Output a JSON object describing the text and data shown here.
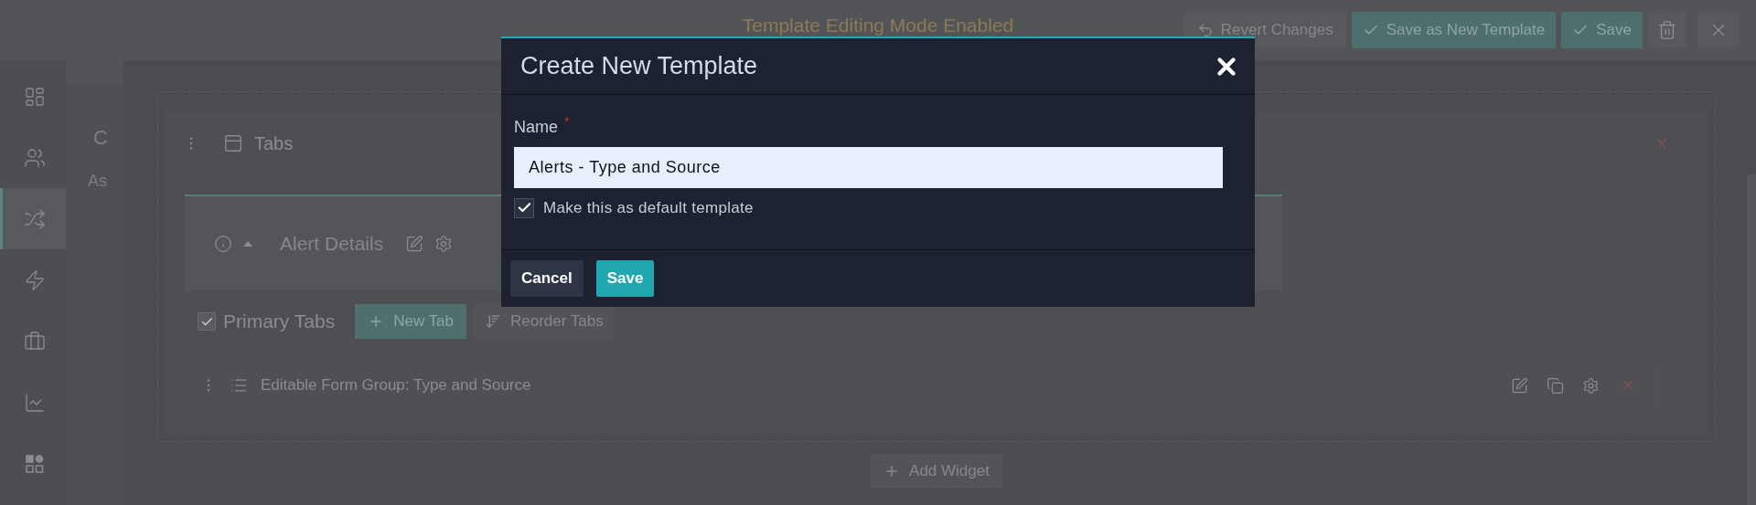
{
  "topbar": {
    "title": "Template Editing Mode Enabled",
    "actions": [
      {
        "label": "Revert Changes",
        "kind": "revert"
      },
      {
        "label": "Save as New Template",
        "kind": "confirm"
      },
      {
        "label": "Save",
        "kind": "confirm"
      }
    ]
  },
  "sidebar": {
    "items": [
      {
        "selected": false
      },
      {
        "selected": false
      },
      {
        "selected": true
      },
      {
        "selected": false
      },
      {
        "selected": false
      },
      {
        "selected": false
      },
      {
        "selected": false
      }
    ]
  },
  "secondary_panel": {
    "title": "C",
    "subtitle": "As"
  },
  "canvas": {
    "tabs_widget": {
      "title": "Tabs"
    },
    "tabs": [
      {
        "label": "Alert Details",
        "selected": true
      }
    ],
    "primary_tabs": {
      "label": "Primary Tabs",
      "checked": true
    },
    "tab_buttons": [
      {
        "label": "New Tab",
        "kind": "add"
      },
      {
        "label": "Reorder Tabs",
        "kind": "reorder"
      }
    ],
    "widgets": [
      {
        "label": "Editable Form Group: Type and Source"
      }
    ],
    "add_widget": "Add Widget"
  },
  "dialog": {
    "title": "Create New Template",
    "field": {
      "label": "Name",
      "required_mark": "*",
      "value": "Alerts - Type and Source"
    },
    "default_checkbox": {
      "label": "Make this as default template",
      "checked": true
    },
    "buttons": [
      {
        "label": "Cancel",
        "kind": "secondary"
      },
      {
        "label": "Save",
        "kind": "primary"
      }
    ]
  }
}
